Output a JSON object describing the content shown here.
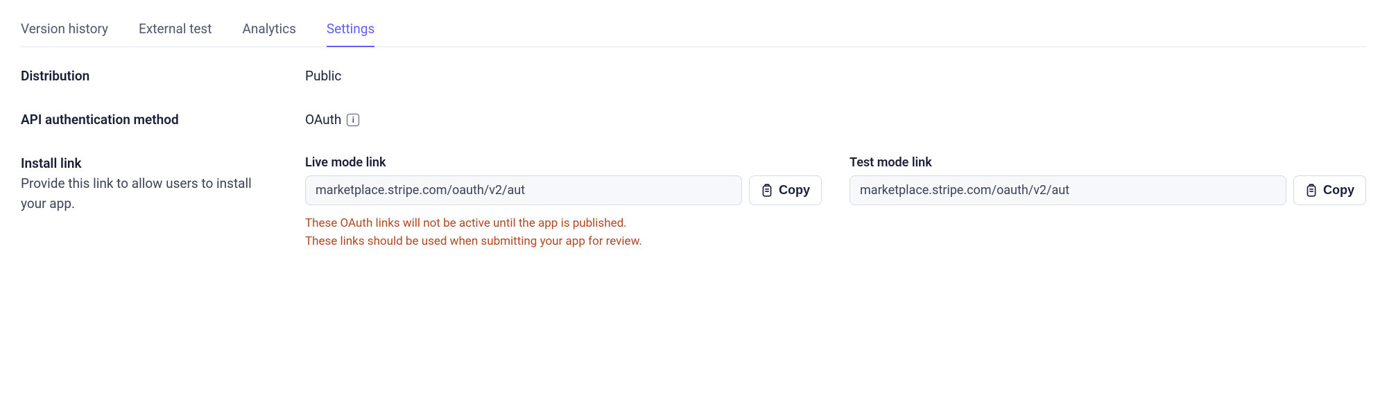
{
  "tabs": [
    {
      "label": "Version history",
      "active": false
    },
    {
      "label": "External test",
      "active": false
    },
    {
      "label": "Analytics",
      "active": false
    },
    {
      "label": "Settings",
      "active": true
    }
  ],
  "distribution": {
    "label": "Distribution",
    "value": "Public"
  },
  "auth": {
    "label": "API authentication method",
    "value": "OAuth"
  },
  "install_link": {
    "label": "Install link",
    "desc": "Provide this link to allow users to install your app.",
    "live": {
      "label": "Live mode link",
      "value": "marketplace.stripe.com/oauth/v2/aut",
      "copy": "Copy"
    },
    "test": {
      "label": "Test mode link",
      "value": "marketplace.stripe.com/oauth/v2/aut",
      "copy": "Copy"
    },
    "warning_line1": "These OAuth links will not be active until the app is published.",
    "warning_line2": "These links should be used when submitting your app for review."
  }
}
